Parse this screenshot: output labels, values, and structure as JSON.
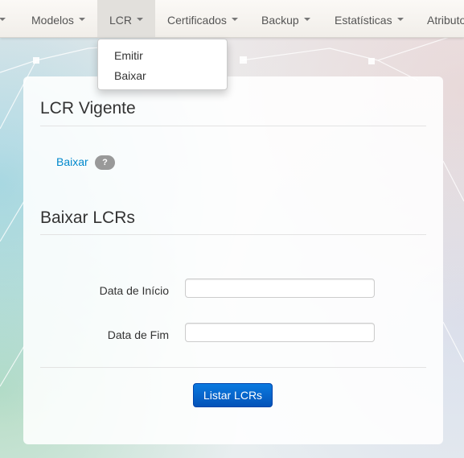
{
  "navbar": {
    "items": [
      {
        "label": "Modelos"
      },
      {
        "label": "LCR"
      },
      {
        "label": "Certificados"
      },
      {
        "label": "Backup"
      },
      {
        "label": "Estatísticas"
      },
      {
        "label": "Atributos"
      }
    ]
  },
  "lcr_menu": {
    "items": [
      {
        "label": "Emitir"
      },
      {
        "label": "Baixar"
      }
    ]
  },
  "vigente": {
    "title": "LCR Vigente",
    "link_label": "Baixar",
    "help_label": "?"
  },
  "baixar_lcrs": {
    "title": "Baixar LCRs",
    "start_label": "Data de Início",
    "start_value": "",
    "end_label": "Data de Fim",
    "end_value": "",
    "button_label": "Listar LCRs"
  },
  "colors": {
    "link": "#0088cc",
    "primary_button": "#0a6fd8",
    "badge": "#999999"
  }
}
